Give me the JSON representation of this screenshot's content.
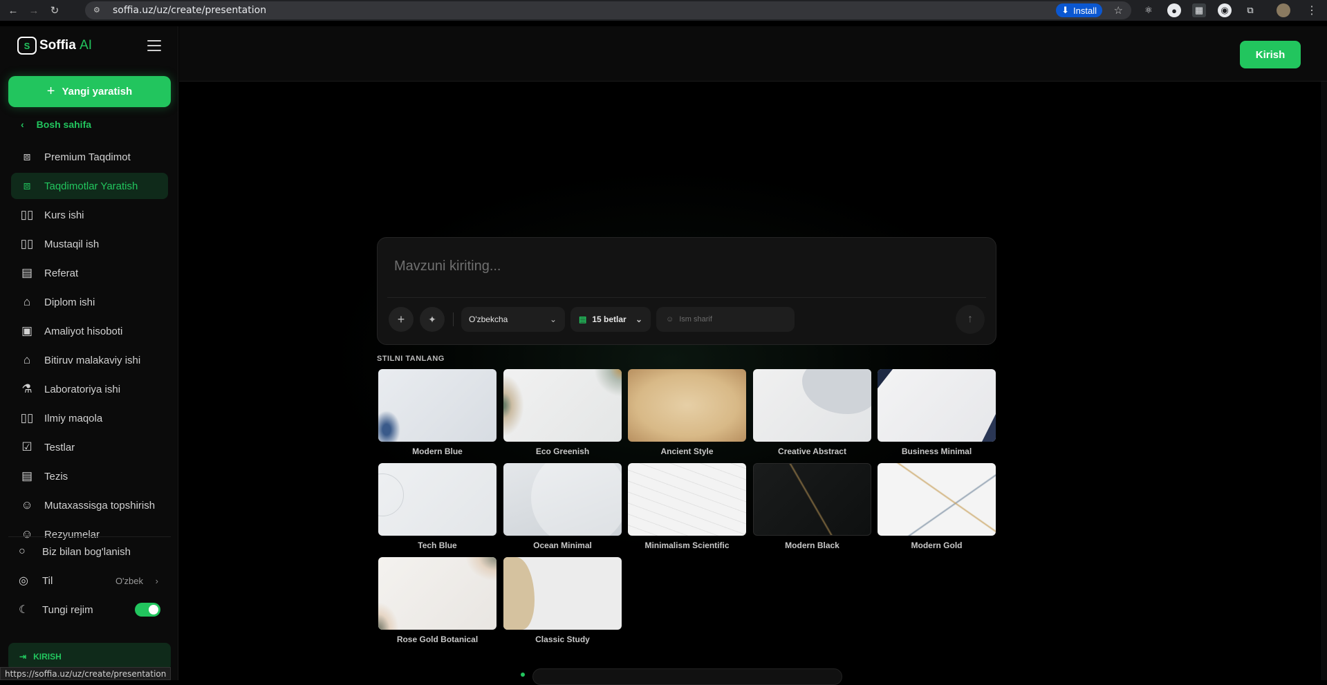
{
  "browser": {
    "url": "soffia.uz/uz/create/presentation",
    "install_label": "Install"
  },
  "sidebar": {
    "logo_text": "Soffia",
    "logo_ai": "AI",
    "new_button": "Yangi yaratish",
    "home_link": "Bosh sahifa",
    "items": [
      {
        "label": "Premium Taqdimot",
        "icon": "presentation-crown-icon"
      },
      {
        "label": "Taqdimotlar Yaratish",
        "icon": "presentation-chart-icon",
        "active": true
      },
      {
        "label": "Kurs ishi",
        "icon": "book-open-icon"
      },
      {
        "label": "Mustaqil ish",
        "icon": "book-open-icon"
      },
      {
        "label": "Referat",
        "icon": "document-icon"
      },
      {
        "label": "Diplom ishi",
        "icon": "graduation-cap-icon"
      },
      {
        "label": "Amaliyot hisoboti",
        "icon": "briefcase-icon"
      },
      {
        "label": "Bitiruv malakaviy ishi",
        "icon": "graduation-cap-icon"
      },
      {
        "label": "Laboratoriya ishi",
        "icon": "flask-icon"
      },
      {
        "label": "Ilmiy maqola",
        "icon": "book-open-icon"
      },
      {
        "label": "Testlar",
        "icon": "clipboard-check-icon"
      },
      {
        "label": "Tezis",
        "icon": "document-icon"
      },
      {
        "label": "Mutaxassisga topshirish",
        "icon": "user-icon"
      },
      {
        "label": "Rezyumelar",
        "icon": "user-icon"
      }
    ],
    "contact": "Biz bilan bog'lanish",
    "language_label": "Til",
    "language_value": "O'zbek",
    "night_mode": "Tungi rejim",
    "login_label": "KIRISH"
  },
  "topbar": {
    "login_button": "Kirish"
  },
  "prompt": {
    "placeholder": "Mavzuni kiriting...",
    "language": "O'zbekcha",
    "pages": "15 betlar",
    "name_placeholder": "Ism sharif"
  },
  "styles": {
    "heading": "STILNI TANLANG",
    "items": [
      {
        "name": "Modern Blue"
      },
      {
        "name": "Eco Greenish"
      },
      {
        "name": "Ancient Style"
      },
      {
        "name": "Creative Abstract"
      },
      {
        "name": "Business Minimal"
      },
      {
        "name": "Tech Blue"
      },
      {
        "name": "Ocean Minimal"
      },
      {
        "name": "Minimalism Scientific"
      },
      {
        "name": "Modern Black"
      },
      {
        "name": "Modern Gold"
      },
      {
        "name": "Rose Gold Botanical"
      },
      {
        "name": "Classic Study"
      }
    ]
  },
  "status_bar_url": "https://soffia.uz/uz/create/presentation",
  "colors": {
    "accent": "#22c55e",
    "background": "#000000",
    "sidebar": "#0b0b0b"
  }
}
